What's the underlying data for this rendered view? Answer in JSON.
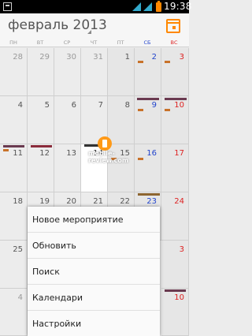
{
  "status_bar": {
    "time": "19:38"
  },
  "header": {
    "month_title": "февраль 2013"
  },
  "weekdays": [
    "ПН",
    "ВТ",
    "СР",
    "ЧТ",
    "ПТ",
    "СБ",
    "ВС"
  ],
  "weeks": [
    [
      "28",
      "29",
      "30",
      "31",
      "1",
      "2",
      "3"
    ],
    [
      "4",
      "5",
      "6",
      "7",
      "8",
      "9",
      "10"
    ],
    [
      "11",
      "12",
      "13",
      "14",
      "15",
      "16",
      "17"
    ],
    [
      "18",
      "19",
      "20",
      "21",
      "22",
      "23",
      "24"
    ],
    [
      "25",
      "",
      "",
      "",
      "",
      "",
      "3"
    ],
    [
      "4",
      "",
      "",
      "",
      "",
      "",
      "10"
    ]
  ],
  "menu": {
    "items": [
      "Новое мероприятие",
      "Обновить",
      "Поиск",
      "Календари",
      "Настройки"
    ]
  },
  "watermark": {
    "text": "mobile-review.com"
  },
  "colors": {
    "accent": "#ff8800",
    "saturday": "#2244cc",
    "sunday": "#dd2222",
    "event_dark": "#6a3a50",
    "event_orange": "#c8722a"
  }
}
